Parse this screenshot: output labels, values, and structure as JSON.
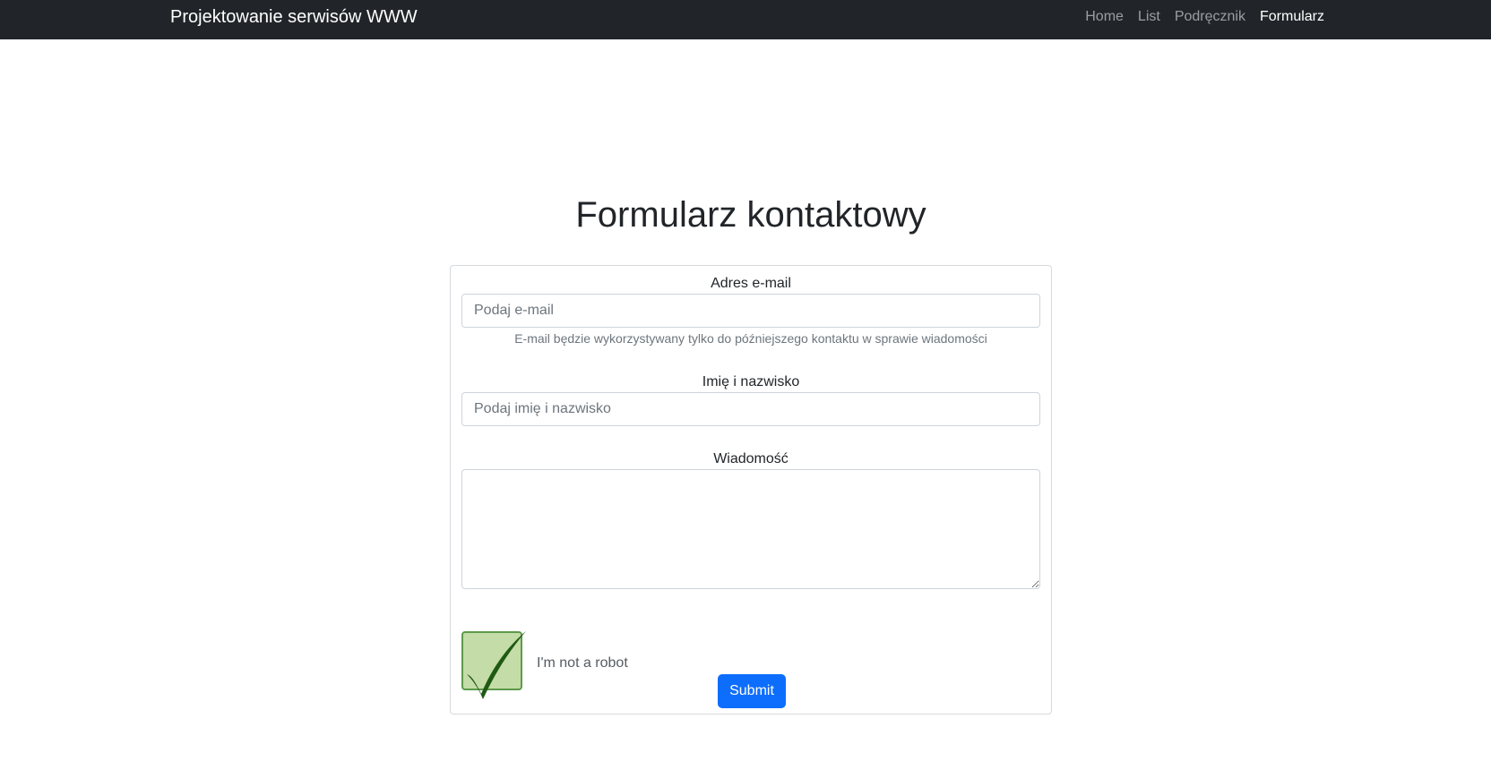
{
  "navbar": {
    "brand": "Projektowanie serwisów WWW",
    "links": [
      {
        "label": "Home",
        "active": false
      },
      {
        "label": "List",
        "active": false
      },
      {
        "label": "Podręcznik",
        "active": false
      },
      {
        "label": "Formularz",
        "active": true
      }
    ]
  },
  "page": {
    "title": "Formularz kontaktowy"
  },
  "form": {
    "email": {
      "label": "Adres e-mail",
      "placeholder": "Podaj e-mail",
      "value": "",
      "help": "E-mail będzie wykorzystywany tylko do późniejszego kontaktu w sprawie wiadomości"
    },
    "name": {
      "label": "Imię i nazwisko",
      "placeholder": "Podaj imię i nazwisko",
      "value": ""
    },
    "message": {
      "label": "Wiadomość",
      "value": ""
    },
    "captcha": {
      "label": "I'm not a robot",
      "checked": true,
      "icon": "checkmark-icon"
    },
    "submit_label": "Submit"
  },
  "colors": {
    "navbar_bg": "#212529",
    "primary": "#0d6efd",
    "captcha_fill": "#c4dca8",
    "captcha_check": "#1f5a12"
  }
}
